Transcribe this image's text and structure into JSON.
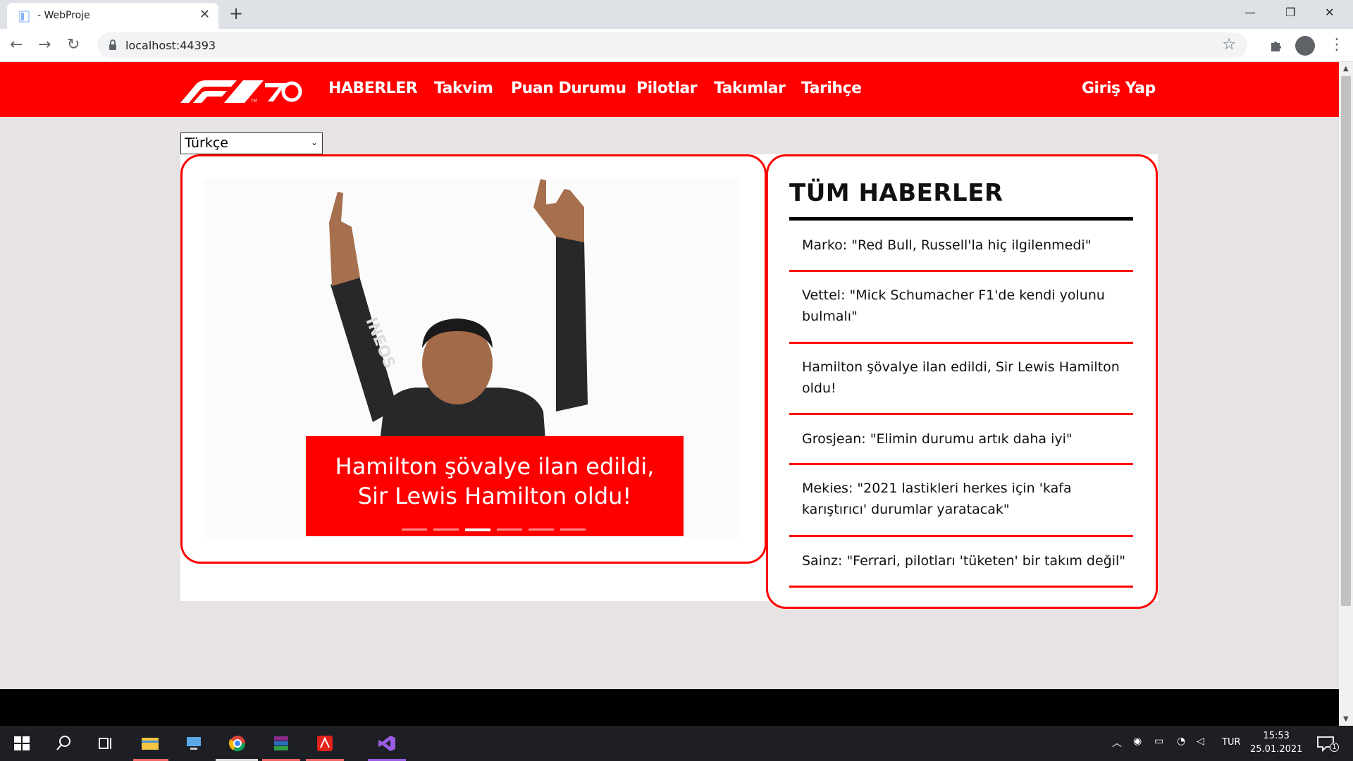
{
  "browser": {
    "tab_title": "- WebProje",
    "url": "localhost:44393"
  },
  "nav": {
    "items": [
      "HABERLER",
      "Takvim",
      "Puan Durumu",
      "Pilotlar",
      "Takımlar",
      "Tarihçe"
    ],
    "login": "Giriş Yap"
  },
  "language_select": {
    "value": "Türkçe"
  },
  "slider": {
    "caption": "Hamilton şövalye ilan edildi, Sir Lewis Hamilton oldu!",
    "active_index": 2,
    "slide_count": 6
  },
  "news": {
    "title": "TÜM HABERLER",
    "items": [
      "Marko: \"Red Bull, Russell'la hiç ilgilenmedi\"",
      "Vettel: \"Mick Schumacher F1'de kendi yolunu bulmalı\"",
      "Hamilton şövalye ilan edildi, Sir Lewis Hamilton oldu!",
      "Grosjean: \"Elimin durumu artık daha iyi\"",
      "Mekies: \"2021 lastikleri herkes için 'kafa karıştırıcı' durumlar yaratacak\"",
      "Sainz: \"Ferrari, pilotları 'tüketen' bir takım değil\""
    ]
  },
  "taskbar": {
    "lang": "TUR",
    "time": "15:53",
    "date": "25.01.2021",
    "notification_count": "1"
  },
  "colors": {
    "brand_red": "#ff0000",
    "page_bg": "#e7e3e3"
  }
}
